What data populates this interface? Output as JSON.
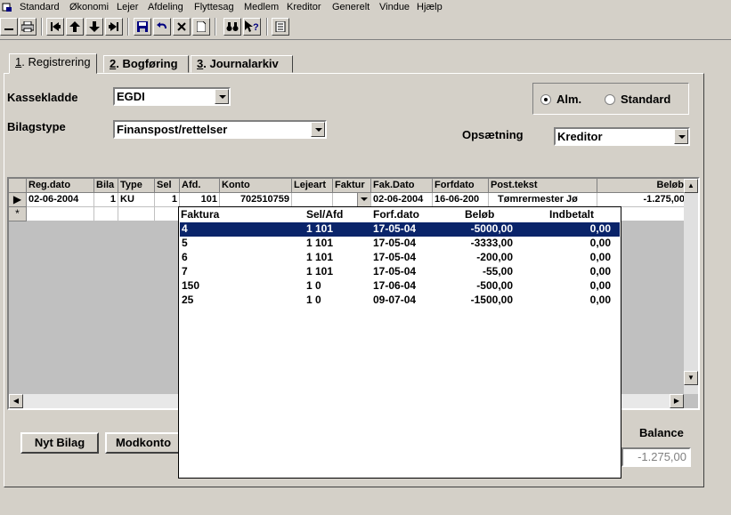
{
  "menubar": {
    "items": [
      "Standard",
      "Økonomi",
      "Lejer",
      "Afdeling",
      "Flyttesag",
      "Medlem",
      "Kreditor",
      "Generelt",
      "Vindue",
      "Hjælp"
    ]
  },
  "toolbar": {
    "icons": [
      "minimize-icon",
      "print-icon",
      "first-record-icon",
      "previous-record-icon",
      "next-record-icon",
      "last-record-icon",
      "save-icon",
      "undo-icon",
      "delete-icon",
      "new-record-icon",
      "find-icon",
      "help-pointer-icon",
      "notes-icon"
    ]
  },
  "tabs": [
    {
      "num": "1",
      "label": ". Registrering"
    },
    {
      "num": "2",
      "label": ". Bogføring"
    },
    {
      "num": "3",
      "label": ". Journalarkiv"
    }
  ],
  "form": {
    "kassekladde_label": "Kassekladde",
    "kassekladde_value": "EGDI",
    "bilagstype_label": "Bilagstype",
    "bilagstype_value": "Finanspost/rettelser",
    "opsaetning_label": "Opsætning",
    "opsaetning_value": "Kreditor",
    "radio_alm": "Alm.",
    "radio_standard": "Standard",
    "radio_selected": "Alm."
  },
  "grid": {
    "columns": [
      "Reg.dato",
      "Bila",
      "Type",
      "Sel",
      "Afd.",
      "Konto",
      "Lejeart",
      "Faktur",
      "Fak.Dato",
      "Forfdato",
      "Post.tekst",
      "Beløb"
    ],
    "rows": [
      [
        "02-06-2004",
        "1",
        "KU",
        "1",
        "101",
        "702510759",
        "",
        "",
        "02-06-2004",
        "16-06-200",
        "Tømrermester Jø",
        "-1.275,00"
      ]
    ],
    "new_row_marker": "*",
    "current_row_marker": "▶"
  },
  "dropdown": {
    "columns": [
      "Faktura",
      "Sel/Afd",
      "Forf.dato",
      "Beløb",
      "Indbetalt"
    ],
    "rows": [
      [
        "4",
        "1 101",
        "17-05-04",
        "-5000,00",
        "0,00"
      ],
      [
        "5",
        "1 101",
        "17-05-04",
        "-3333,00",
        "0,00"
      ],
      [
        "6",
        "1 101",
        "17-05-04",
        "-200,00",
        "0,00"
      ],
      [
        "7",
        "1 101",
        "17-05-04",
        "-55,00",
        "0,00"
      ],
      [
        "150",
        "1 0",
        "17-06-04",
        "-500,00",
        "0,00"
      ],
      [
        "25",
        "1 0",
        "09-07-04",
        "-1500,00",
        "0,00"
      ]
    ],
    "selected_index": 0
  },
  "buttons": {
    "nyt_bilag": "Nyt Bilag",
    "modkonto": "Modkonto"
  },
  "balance": {
    "label": "Balance",
    "value": "-1.275,00"
  }
}
